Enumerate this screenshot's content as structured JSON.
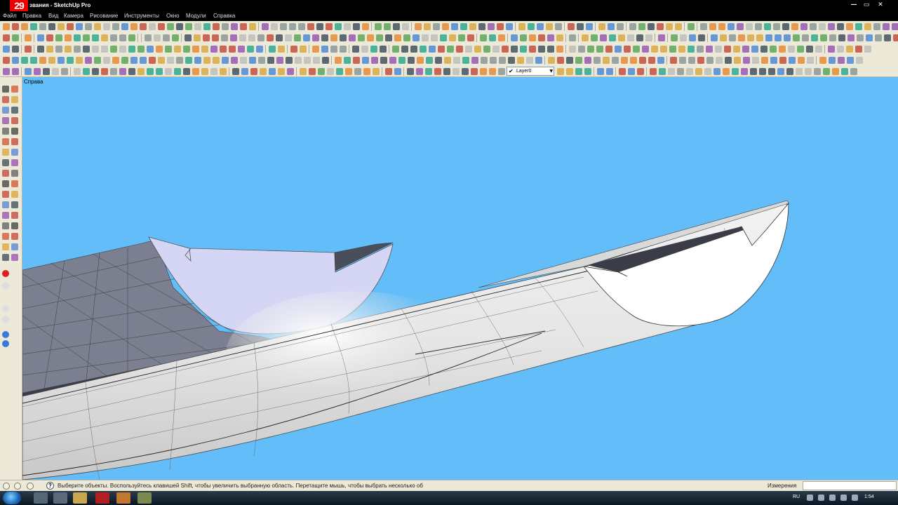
{
  "app": {
    "badge": "29",
    "title": "звания - SketchUp Pro"
  },
  "window_controls": {
    "minimize": "—",
    "maximize": "▭",
    "close": "✕"
  },
  "menu": {
    "items": [
      "Файл",
      "Правка",
      "Вид",
      "Камера",
      "Рисование",
      "Инструменты",
      "Окно",
      "Модули",
      "Справка"
    ]
  },
  "toolbar": {
    "layer": {
      "checked": "✔",
      "value": "Layer0",
      "dropdown": "▼"
    }
  },
  "viewport": {
    "scene_label": "Справа",
    "background": "#63bdf8"
  },
  "statusbar": {
    "help": "?",
    "text": "Выберите объекты. Воспользуйтесь клавишей Shift, чтобы увеличить выбранную область. Перетащите мышь, чтобы выбрать несколько об",
    "measure_label": "Измерения",
    "measure_value": ""
  },
  "taskbar": {
    "language": "RU",
    "clock": "1:54"
  },
  "colors": {
    "accent_red": "#e00000",
    "chrome": "#ece9d8",
    "sky": "#63bdf8"
  }
}
